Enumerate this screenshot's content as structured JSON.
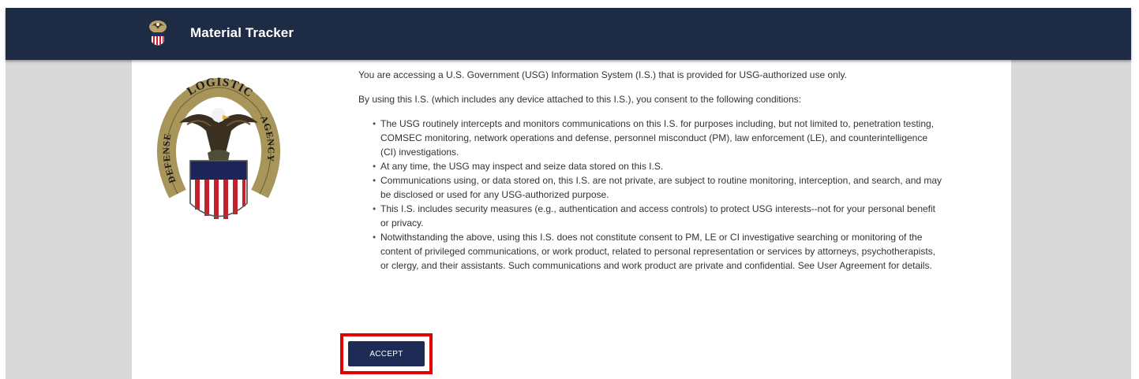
{
  "app": {
    "title": "Material Tracker",
    "logo_icon": "dla-logo-icon"
  },
  "seal": {
    "icon": "defense-logistics-agency-seal-icon",
    "top_text": "LOGISTICS",
    "left_text": "DEFENSE",
    "right_text": "AGENCY"
  },
  "notice": {
    "intro": "You are accessing a U.S. Government (USG) Information System (I.S.) that is provided for USG-authorized use only.",
    "consent": "By using this I.S. (which includes any device attached to this I.S.), you consent to the following conditions:",
    "conditions": [
      "The USG routinely intercepts and monitors communications on this I.S. for purposes including, but not limited to, penetration testing, COMSEC monitoring, network operations and defense, personnel misconduct (PM), law enforcement (LE), and counterintelligence (CI) investigations.",
      "At any time, the USG may inspect and seize data stored on this I.S.",
      "Communications using, or data stored on, this I.S. are not private, are subject to routine monitoring, interception, and search, and may be disclosed or used for any USG-authorized purpose.",
      "This I.S. includes security measures (e.g., authentication and access controls) to protect USG interests--not for your personal benefit or privacy.",
      "Notwithstanding the above, using this I.S. does not constitute consent to PM, LE or CI investigative searching or monitoring of the content of privileged communications, or work product, related to personal representation or services by attorneys, psychotherapists, or clergy, and their assistants. Such communications and work product are private and confidential. See User Agreement for details."
    ]
  },
  "actions": {
    "accept_label": "ACCEPT"
  },
  "colors": {
    "navbar": "#1d2b45",
    "button": "#1d2b55",
    "highlight": "#e00000",
    "page_bg": "#d9d9d9"
  }
}
